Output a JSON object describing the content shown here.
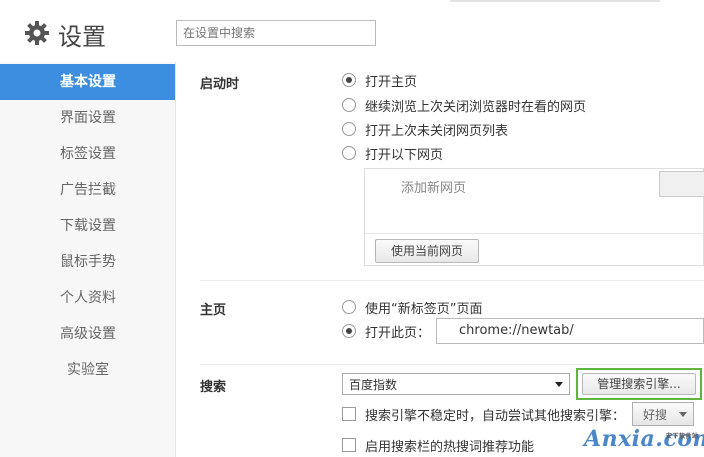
{
  "header": {
    "title": "设置",
    "search_placeholder": "在设置中搜索"
  },
  "sidebar": {
    "items": [
      {
        "label": "基本设置",
        "active": true
      },
      {
        "label": "界面设置"
      },
      {
        "label": "标签设置"
      },
      {
        "label": "广告拦截"
      },
      {
        "label": "下载设置"
      },
      {
        "label": "鼠标手势"
      },
      {
        "label": "个人资料"
      },
      {
        "label": "高级设置"
      },
      {
        "label": "实验室"
      }
    ]
  },
  "startup": {
    "title": "启动时",
    "options": [
      {
        "label": "打开主页",
        "checked": true
      },
      {
        "label": "继续浏览上次关闭浏览器时在看的网页",
        "checked": false
      },
      {
        "label": "打开上次未关闭网页列表",
        "checked": false
      },
      {
        "label": "打开以下网页",
        "checked": false
      }
    ],
    "add_page_placeholder": "添加新网页",
    "use_current_button": "使用当前网页"
  },
  "homepage": {
    "title": "主页",
    "option_newtab": "使用“新标签页”页面",
    "option_open": "打开此页：",
    "url": "chrome://newtab/",
    "selected": "open"
  },
  "search": {
    "title": "搜索",
    "engine": "百度指数",
    "manage_button": "管理搜索引擎...",
    "fallback_label": "搜索引擎不稳定时，自动尝试其他搜索引擎：",
    "fallback_value": "好搜",
    "hotword_label": "启用搜索栏的热搜词推荐功能"
  },
  "watermark": {
    "text": "Anxia.com",
    "sub": "安下软件站"
  },
  "colors": {
    "accent": "#3c8fe0",
    "highlight_border": "#5fb53e"
  }
}
